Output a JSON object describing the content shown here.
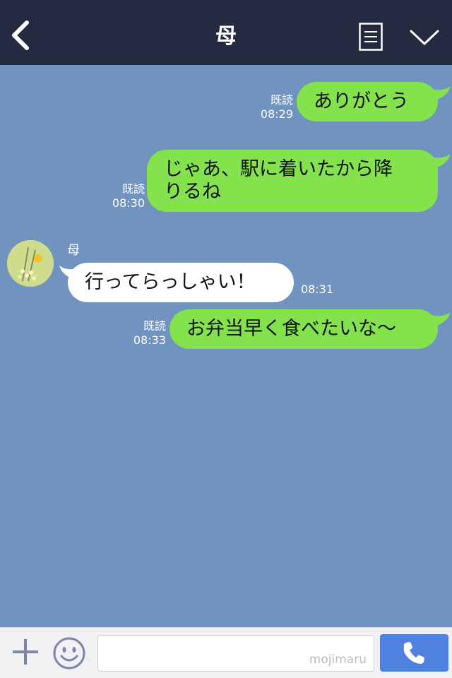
{
  "header": {
    "title": "母"
  },
  "messages": [
    {
      "type": "sent",
      "text": "ありがとう",
      "read": "既読",
      "time": "08:29"
    },
    {
      "type": "sent",
      "line1": "じゃあ、駅に着いたから降",
      "line2": "りるね",
      "read": "既読",
      "time": "08:30"
    },
    {
      "type": "received",
      "sender": "母",
      "text": "行ってらっしゃい！",
      "time": "08:31"
    },
    {
      "type": "sent",
      "text": "お弁当早く食べたいな〜",
      "read": "既読",
      "time": "08:33"
    }
  ],
  "input": {
    "watermark": "mojimaru"
  },
  "colors": {
    "header_bg": "#242b40",
    "chat_bg": "#7093c0",
    "sent_bubble": "#84e24c",
    "received_bubble": "#ffffff",
    "call_button": "#4f82e0"
  },
  "icons": [
    "back-arrow-icon",
    "menu-list-icon",
    "chevron-down-icon",
    "plus-icon",
    "smiley-icon",
    "phone-icon"
  ]
}
